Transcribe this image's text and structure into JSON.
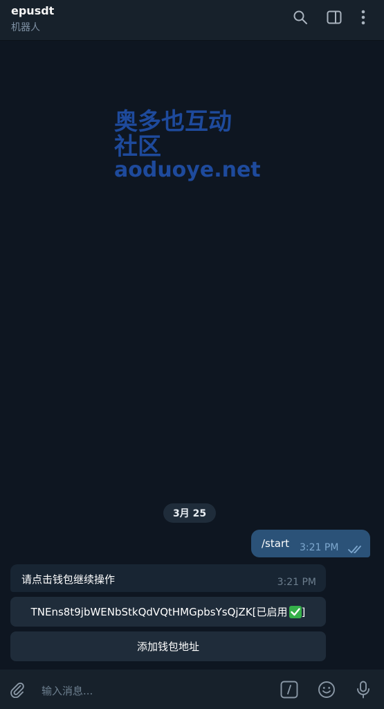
{
  "header": {
    "title": "epusdt",
    "subtitle": "机器人",
    "icons": [
      "search-icon",
      "sidebar-toggle-icon",
      "more-vertical-icon"
    ]
  },
  "watermark": {
    "line1": "奥多也互动社区",
    "line2": "aoduoye.net"
  },
  "date_separator": "3月 25",
  "messages": [
    {
      "direction": "out",
      "text": "/start",
      "time": "3:21 PM",
      "status": "read"
    },
    {
      "direction": "in",
      "text": "请点击钱包继续操作",
      "time": "3:21 PM"
    }
  ],
  "inline_keyboard": {
    "wallet_button": "TNEns8t9jbWENbStkQdVQtHMGpbsYsQjZK[已启用",
    "add_wallet_button": "添加钱包地址"
  },
  "composer": {
    "placeholder": "输入消息...",
    "icons": [
      "attach-icon",
      "bot-commands-icon",
      "emoji-icon",
      "microphone-icon"
    ]
  },
  "colors": {
    "background": "#0e1621",
    "header": "#17212b",
    "outgoing_bubble": "#2b5278",
    "incoming_bubble": "#182533",
    "keyboard_button": "#1f2c3a",
    "watermark": "#1e4a9c",
    "check_badge": "#35b04a"
  }
}
